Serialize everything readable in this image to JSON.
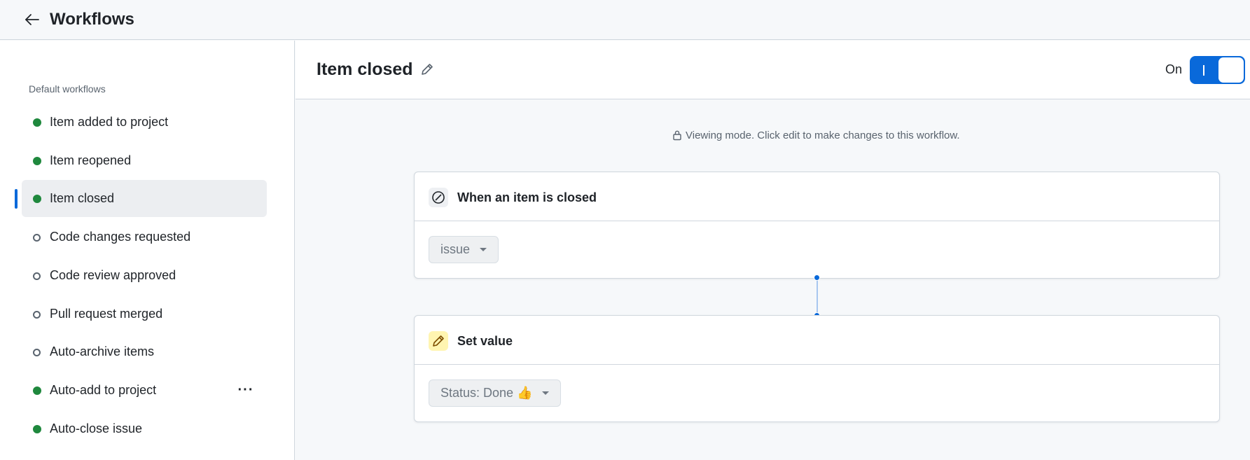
{
  "header": {
    "title": "Workflows"
  },
  "sidebar": {
    "heading": "Default workflows",
    "items": [
      {
        "label": "Item added to project",
        "enabled": true
      },
      {
        "label": "Item reopened",
        "enabled": true
      },
      {
        "label": "Item closed",
        "enabled": true,
        "active": true
      },
      {
        "label": "Code changes requested",
        "enabled": false
      },
      {
        "label": "Code review approved",
        "enabled": false
      },
      {
        "label": "Pull request merged",
        "enabled": false
      },
      {
        "label": "Auto-archive items",
        "enabled": false
      },
      {
        "label": "Auto-add to project",
        "enabled": true
      },
      {
        "label": "Auto-close issue",
        "enabled": true
      }
    ],
    "more_icon": "kebab-horizontal-icon"
  },
  "workflow": {
    "title": "Item closed",
    "toggle_label": "On",
    "toggle_on": true,
    "notice": "Viewing mode. Click edit to make changes to this workflow.",
    "trigger": {
      "title": "When an item is closed",
      "select_value": "issue",
      "icon": "skip-circle-icon"
    },
    "action": {
      "title": "Set value",
      "select_value": "Status: Done 👍",
      "icon": "pencil-icon"
    }
  },
  "colors": {
    "accent": "#0969da",
    "enabled_dot": "#1f883d",
    "action_icon_bg": "#fff5b1"
  }
}
